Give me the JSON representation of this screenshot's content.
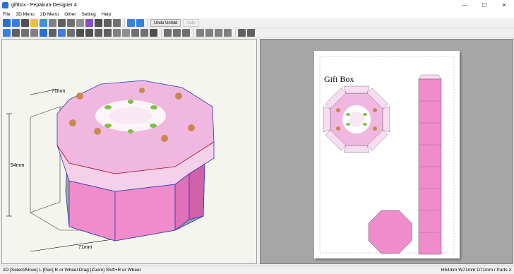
{
  "window": {
    "title": "giftbox - Pepakura Designer 4",
    "minimize": "—",
    "maximize": "☐",
    "close": "✕"
  },
  "menu": [
    "File",
    "3D Menu",
    "2D Menu",
    "Other",
    "Setting",
    "Help"
  ],
  "toolbar": {
    "undo_unfold": "Undo Unfold",
    "auto": "Auto"
  },
  "view3d": {
    "dim_top": "71mm",
    "dim_left": "54mm",
    "dim_bottom": "71mm"
  },
  "view2d": {
    "paper_title": "Gift Box"
  },
  "status": {
    "left": "2D [Select/Move] L [Pan] R or Wheel Drag [Zoom] Shift+R or Wheel",
    "right": "H54mm W71mm D71mm / Parts 2"
  },
  "colors": {
    "lid": "#f0b8e0",
    "box_side": "#f08ccc",
    "box_inner": "#a0a0a0",
    "edge_blue": "#2a3ab8",
    "edge_red": "#d02020"
  }
}
